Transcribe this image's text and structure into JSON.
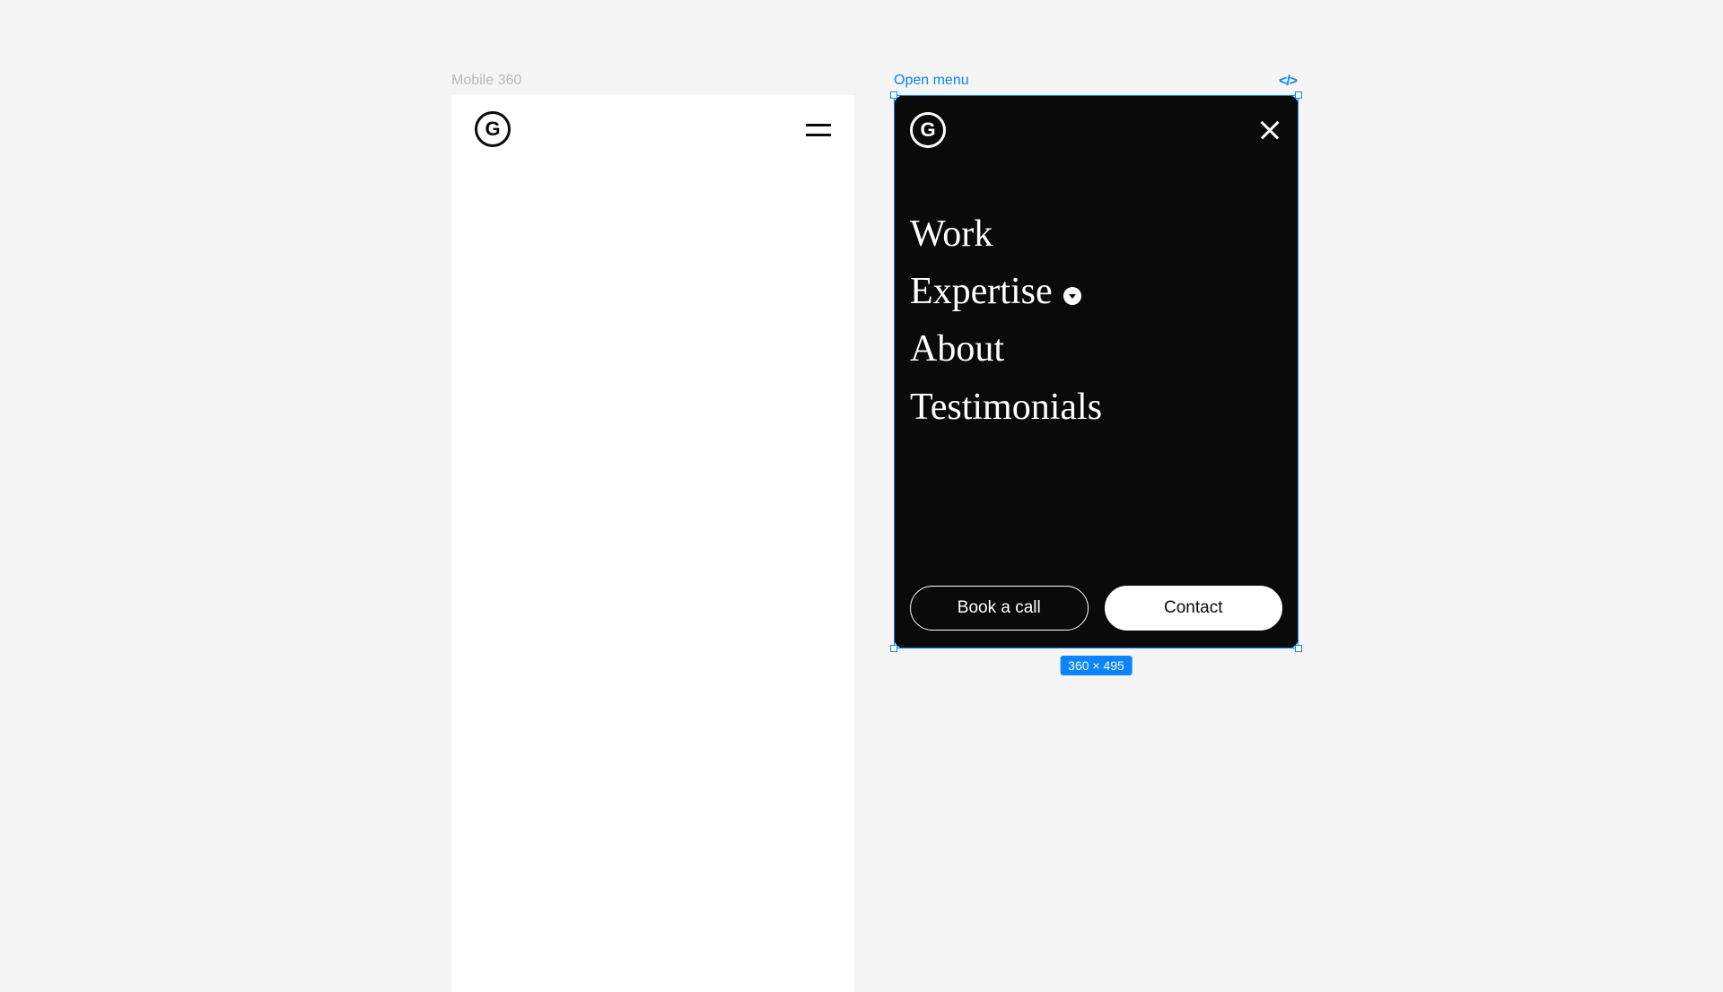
{
  "frames": {
    "mobile": {
      "label": "Mobile 360",
      "logo_letter": "G"
    },
    "menu": {
      "label": "Open menu",
      "logo_letter": "G",
      "size_badge": "360 × 495"
    }
  },
  "menu": {
    "items": [
      {
        "label": "Work",
        "expandable": false
      },
      {
        "label": "Expertise",
        "expandable": true
      },
      {
        "label": "About",
        "expandable": false
      },
      {
        "label": "Testimonials",
        "expandable": false
      }
    ],
    "book_label": "Book a call",
    "contact_label": "Contact"
  }
}
